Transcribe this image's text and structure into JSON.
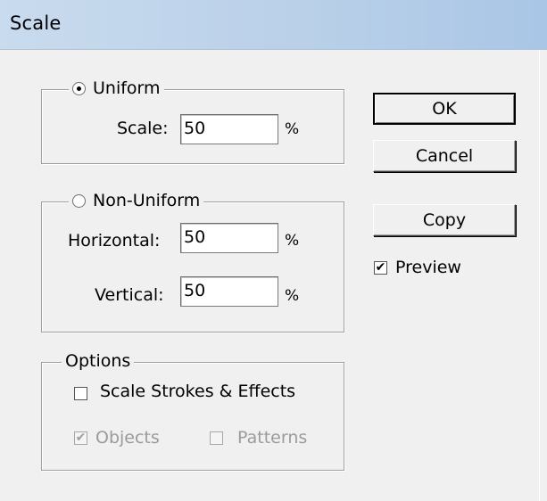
{
  "window": {
    "title": "Scale"
  },
  "uniform": {
    "radio_label": "Uniform",
    "selected": true,
    "scale_label": "Scale:",
    "scale_value": "50",
    "unit": "%"
  },
  "non_uniform": {
    "radio_label": "Non-Uniform",
    "selected": false,
    "horizontal_label": "Horizontal:",
    "horizontal_value": "50",
    "vertical_label": "Vertical:",
    "vertical_value": "50",
    "unit": "%"
  },
  "options": {
    "title": "Options",
    "scale_strokes_label": "Scale Strokes & Effects",
    "scale_strokes_checked": false,
    "objects_label": "Objects",
    "objects_checked": true,
    "patterns_label": "Patterns",
    "patterns_checked": false
  },
  "buttons": {
    "ok": "OK",
    "cancel": "Cancel",
    "copy": "Copy"
  },
  "preview": {
    "label": "Preview",
    "checked": true
  }
}
